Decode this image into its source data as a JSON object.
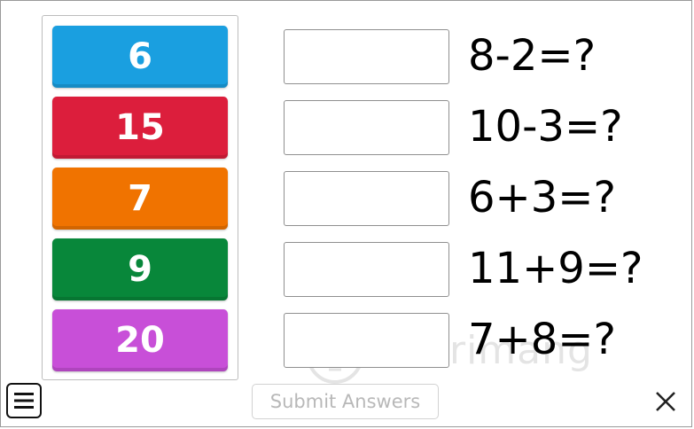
{
  "tiles": [
    {
      "value": "6",
      "color": "#1a9fe0"
    },
    {
      "value": "15",
      "color": "#dc1e3c"
    },
    {
      "value": "7",
      "color": "#f07300"
    },
    {
      "value": "9",
      "color": "#08873a"
    },
    {
      "value": "20",
      "color": "#c84fd8"
    }
  ],
  "questions": [
    "8-2=?",
    "10-3=?",
    "6+3=?",
    "11+9=?",
    "7+8=?"
  ],
  "submit_label": "Submit Answers",
  "watermark_text": "uantrimang",
  "icons": {
    "menu": "hamburger-menu-icon",
    "close": "close-icon",
    "watermark": "lightbulb-icon"
  }
}
